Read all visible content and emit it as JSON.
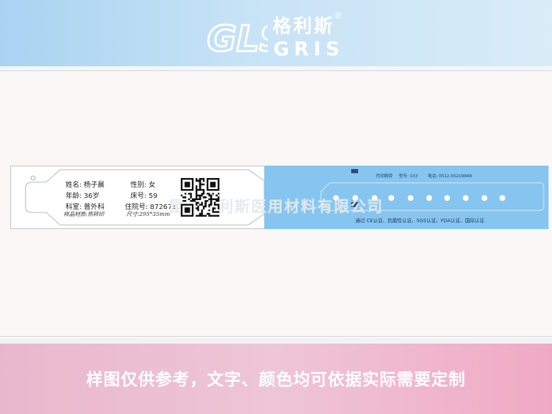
{
  "brand": {
    "mark": "GLS",
    "cn": "格利斯",
    "reg": "®",
    "en": "GRIS"
  },
  "wristband": {
    "fields": {
      "name": {
        "label": "姓名:",
        "value": "杨子晨"
      },
      "gender": {
        "label": "性别:",
        "value": "女"
      },
      "age": {
        "label": "年龄:",
        "value": "36岁"
      },
      "bed": {
        "label": "床号:",
        "value": "59"
      },
      "dept": {
        "label": "科室:",
        "value": "普外科"
      },
      "admission": {
        "label": "住院号:",
        "value": "872671"
      }
    },
    "material": {
      "label": "样品材质:",
      "value": "热转印"
    },
    "size": {
      "label": "尺寸:",
      "value": "295*35mm"
    },
    "watermark": "昆山格利斯医用材料有限公司",
    "strip": {
      "title": "打印腕带",
      "model": "型号: 103",
      "phone": "电话: 0512-55219949",
      "certs": "通过 CE认证、抗菌性认证、SGS认证、FDA认证、国际认证"
    }
  },
  "footer_note": "样图仅供参考，文字、颜色均可依据实际需要定制",
  "colors": {
    "header_blue": "#a9d3f1",
    "band_blue": "#86c5ef",
    "footer_pink": "#eec6d6",
    "background": "#fbf7f6"
  }
}
